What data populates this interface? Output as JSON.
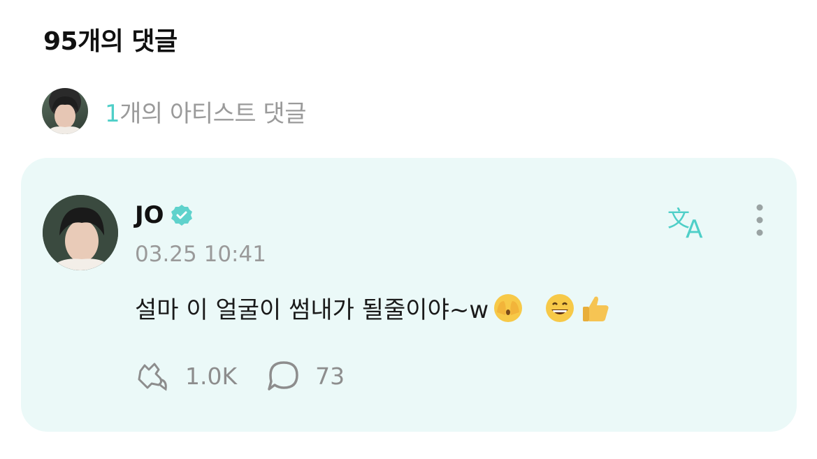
{
  "header": {
    "title": "95개의 댓글"
  },
  "artist_comments": {
    "count": "1",
    "label": "개의 아티스트 댓글"
  },
  "comment": {
    "author": "JO",
    "timestamp": "03.25 10:41",
    "text": "설마 이 얼굴이 썸내가 될줄이야~w",
    "likes": "1.0K",
    "replies": "73"
  },
  "colors": {
    "accent": "#4fcfc8",
    "card_bg": "#ebf9f8",
    "muted": "#9a9a9a"
  },
  "icons": [
    "verified-badge-icon",
    "translate-icon",
    "more-vertical-icon",
    "like-icon",
    "reply-bubble-icon"
  ]
}
